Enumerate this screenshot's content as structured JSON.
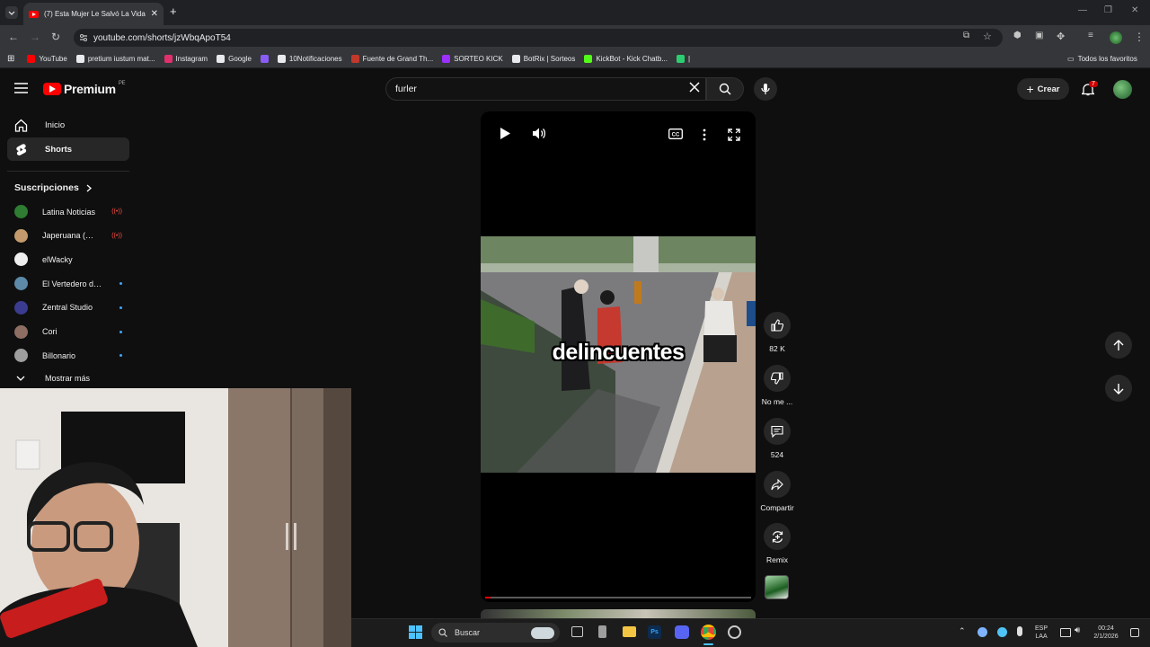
{
  "browser": {
    "tab_title": "(7) Esta Mujer Le Salvó La Vida",
    "url": "youtube.com/shorts/jzWbqApoT54",
    "bookmarks": [
      {
        "label": "YouTube",
        "color": "#ff0000"
      },
      {
        "label": "pretium iustum mat...",
        "color": "#e8eaed"
      },
      {
        "label": "Instagram",
        "color": "#e1306c"
      },
      {
        "label": "Google",
        "color": "#e8eaed"
      },
      {
        "label": "",
        "color": "#8a5cf6"
      },
      {
        "label": "10Notificaciones",
        "color": "#e8eaed"
      },
      {
        "label": "Fuente de Grand Th...",
        "color": "#c0392b"
      },
      {
        "label": "SORTEO KICK",
        "color": "#9b30ff"
      },
      {
        "label": "BotRix | Sorteos",
        "color": "#e8eaed"
      },
      {
        "label": "KickBot - Kick Chatb...",
        "color": "#53fc18"
      },
      {
        "label": "|",
        "color": "#2ecc71"
      }
    ],
    "all_bookmarks": "Todos los favoritos"
  },
  "header": {
    "logo_text": "Premium",
    "region": "PE",
    "search_value": "furler",
    "create_label": "Crear",
    "notifications_count": "7"
  },
  "sidebar": {
    "items": [
      {
        "label": "Inicio",
        "icon": "home-icon"
      },
      {
        "label": "Shorts",
        "icon": "shorts-icon"
      }
    ],
    "subscriptions_title": "Suscripciones",
    "subscriptions": [
      {
        "name": "Latina Noticias",
        "status": "live",
        "color": "#2e7d32"
      },
      {
        "name": "Japeruana (Nam...",
        "status": "live",
        "color": "#c49a6c"
      },
      {
        "name": "elWacky",
        "status": "",
        "color": "#eeeeee"
      },
      {
        "name": "El Vertedero de ...",
        "status": "new",
        "color": "#5d8aa8"
      },
      {
        "name": "Zentral Studio",
        "status": "new",
        "color": "#3b3b8f"
      },
      {
        "name": "Cori",
        "status": "new",
        "color": "#8d6e63"
      },
      {
        "name": "Billonario",
        "status": "new",
        "color": "#9e9e9e"
      }
    ],
    "show_more": "Mostrar más"
  },
  "player": {
    "caption": "delincuentes",
    "progress": 0.02
  },
  "actions": {
    "likes": "82 K",
    "dislike_label": "No me ...",
    "comments": "524",
    "share_label": "Compartir",
    "remix_label": "Remix"
  },
  "taskbar": {
    "search_label": "Buscar",
    "lang_top": "ESP",
    "lang_bottom": "LAA",
    "time": "00:24",
    "date": "2/1/2026"
  }
}
